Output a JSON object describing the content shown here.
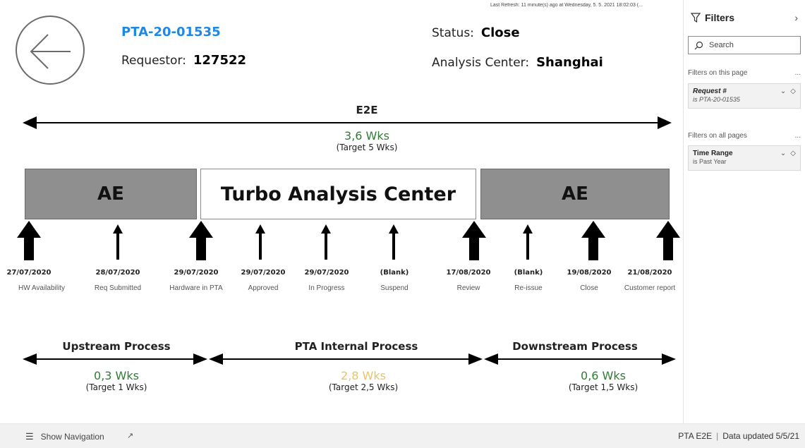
{
  "header": {
    "last_refresh": "Last Refresh: 11 minute(s) ago at Wednesday, 5. 5. 2021 18:02:03 (...",
    "request_id": "PTA-20-01535",
    "requestor_label": "Requestor:",
    "requestor_value": "127522",
    "status_label": "Status:",
    "status_value": "Close",
    "center_label": "Analysis Center:",
    "center_value": "Shanghai"
  },
  "e2e": {
    "title": "E2E",
    "value": "3,6 Wks",
    "target": "(Target 5 Wks)"
  },
  "phases": [
    {
      "label": "AE"
    },
    {
      "label": "Turbo Analysis Center"
    },
    {
      "label": "AE"
    }
  ],
  "milestones": [
    {
      "date": "27/07/2020",
      "label": "HW Availability",
      "big": true
    },
    {
      "date": "28/07/2020",
      "label": "Req Submitted",
      "big": false
    },
    {
      "date": "29/07/2020",
      "label": "Hardware in PTA",
      "big": true
    },
    {
      "date": "29/07/2020",
      "label": "Approved",
      "big": false
    },
    {
      "date": "29/07/2020",
      "label": "In Progress",
      "big": false
    },
    {
      "date": "(Blank)",
      "label": "Suspend",
      "big": false
    },
    {
      "date": "17/08/2020",
      "label": "Review",
      "big": true
    },
    {
      "date": "(Blank)",
      "label": "Re-issue",
      "big": false
    },
    {
      "date": "19/08/2020",
      "label": "Close",
      "big": true
    },
    {
      "date": "21/08/2020",
      "label": "Customer report",
      "big": true
    }
  ],
  "processes": [
    {
      "title": "Upstream Process",
      "value": "0,3 Wks",
      "target": "(Target 1 Wks)",
      "color": "#2e7d32"
    },
    {
      "title": "PTA Internal Process",
      "value": "2,8 Wks",
      "target": "(Target 2,5 Wks)",
      "color": "#e8c36a"
    },
    {
      "title": "Downstream Process",
      "value": "0,6 Wks",
      "target": "(Target 1,5 Wks)",
      "color": "#2e7d32"
    }
  ],
  "filters": {
    "title": "Filters",
    "search_placeholder": "Search",
    "page_section": "Filters on this page",
    "all_section": "Filters on all pages",
    "more": "...",
    "page_filter": {
      "name": "Request #",
      "state": "is PTA-20-01535"
    },
    "all_filter": {
      "name": "Time Range",
      "state": "is Past Year"
    }
  },
  "bottom": {
    "show_navigation": "Show Navigation",
    "page_name": "PTA E2E",
    "data_updated": "Data updated 5/5/21"
  },
  "icons": {
    "back": "back-arrow-icon",
    "filter": "filter-icon",
    "search": "search-icon",
    "chevron": "chevron-down-icon",
    "eraser": "eraser-icon",
    "menu": "hamburger-icon",
    "expand": "expand-icon"
  }
}
